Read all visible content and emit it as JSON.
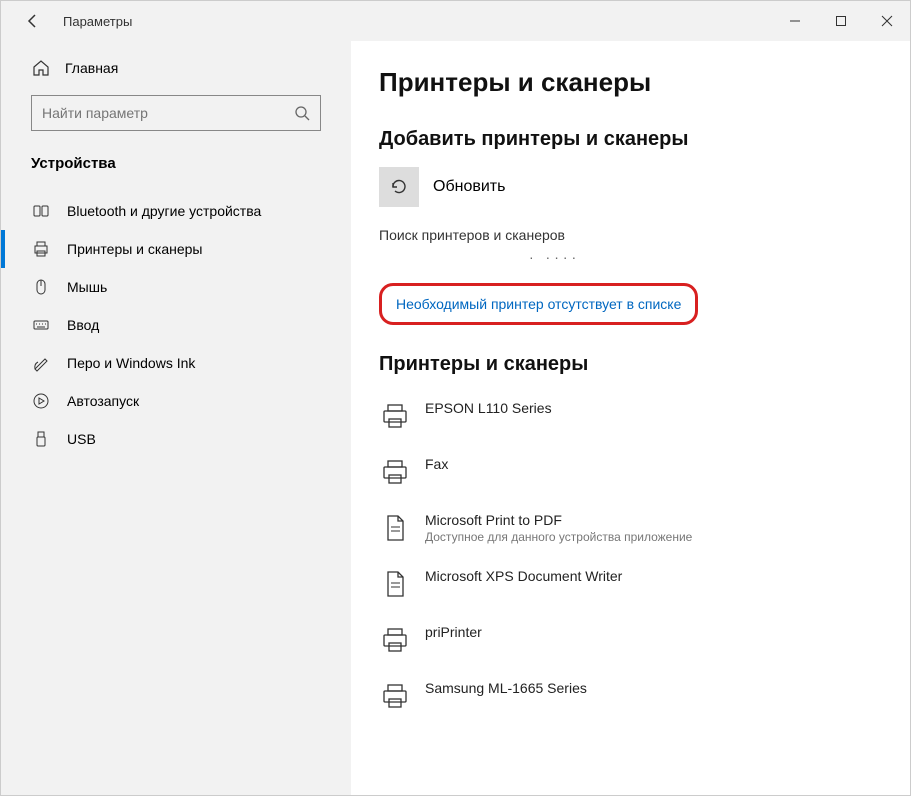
{
  "window": {
    "title": "Параметры"
  },
  "sidebar": {
    "home": "Главная",
    "search_placeholder": "Найти параметр",
    "category": "Устройства",
    "items": [
      {
        "label": "Bluetooth и другие устройства"
      },
      {
        "label": "Принтеры и сканеры"
      },
      {
        "label": "Мышь"
      },
      {
        "label": "Ввод"
      },
      {
        "label": "Перо и Windows Ink"
      },
      {
        "label": "Автозапуск"
      },
      {
        "label": "USB"
      }
    ]
  },
  "main": {
    "title": "Принтеры и сканеры",
    "add_section": "Добавить принтеры и сканеры",
    "refresh_label": "Обновить",
    "searching_label": "Поиск принтеров и сканеров",
    "dots": "·   ····",
    "missing_link": "Необходимый принтер отсутствует в списке",
    "list_section": "Принтеры и сканеры",
    "printers": [
      {
        "name": "EPSON L110 Series",
        "sub": ""
      },
      {
        "name": "Fax",
        "sub": ""
      },
      {
        "name": "Microsoft Print to PDF",
        "sub": "Доступное для данного устройства приложение"
      },
      {
        "name": "Microsoft XPS Document Writer",
        "sub": ""
      },
      {
        "name": "priPrinter",
        "sub": ""
      },
      {
        "name": "Samsung ML-1665 Series",
        "sub": ""
      }
    ]
  }
}
